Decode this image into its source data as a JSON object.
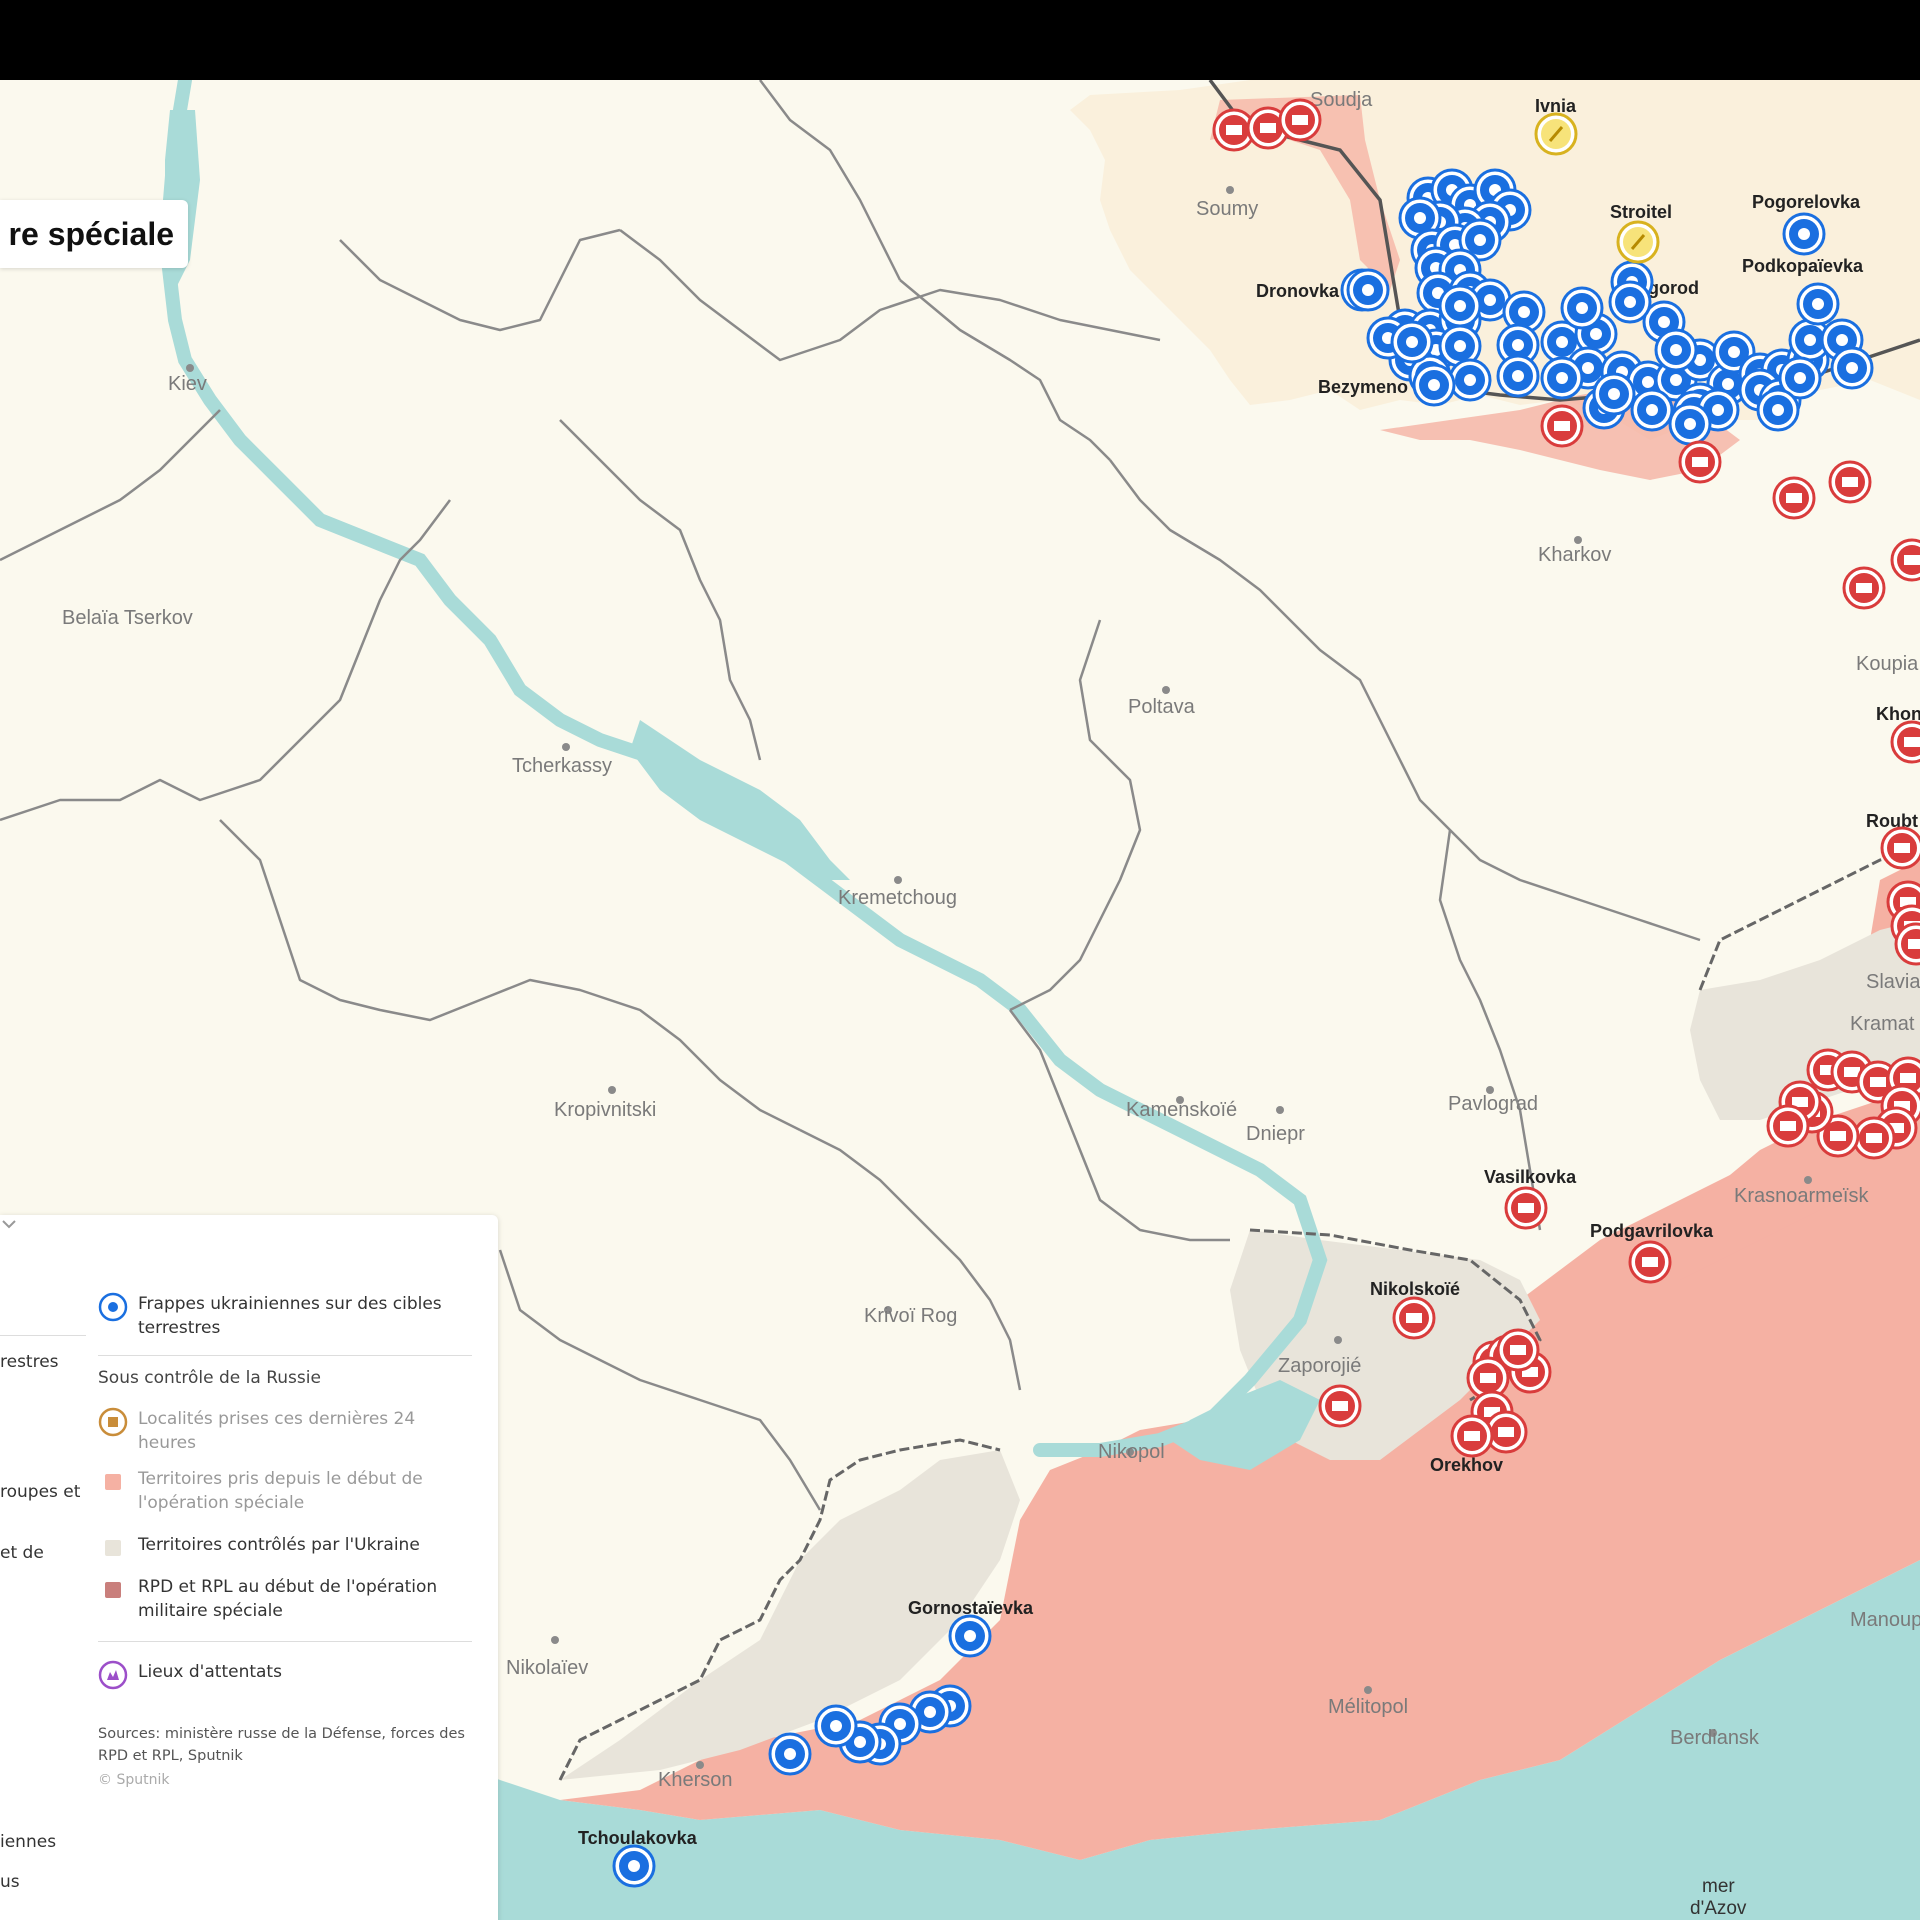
{
  "title": "re spéciale",
  "colors": {
    "land": "#fbf9ee",
    "russia_land": "#faf2de",
    "water": "#a9dbd8",
    "taken_since_start": "#f5b1a3",
    "ukraine_controlled": "#e8e4da",
    "rpd_rpl_start": "#c97f7c",
    "ukrainian_strike": "#1a6fe0",
    "taken_24h": "#c98d3a",
    "attack_site": "#9c4fc9",
    "border": "#6e6e6e"
  },
  "cities": [
    {
      "name": "Kiev"
    },
    {
      "name": "Belaïa Tserkov"
    },
    {
      "name": "Tcherkassy"
    },
    {
      "name": "Poltava"
    },
    {
      "name": "Kharkov"
    },
    {
      "name": "Soumy"
    },
    {
      "name": "Kremetchoug"
    },
    {
      "name": "Kropivnitski"
    },
    {
      "name": "Kamenskoïé"
    },
    {
      "name": "Dniepr"
    },
    {
      "name": "Pavlograd"
    },
    {
      "name": "Krivoï Rog"
    },
    {
      "name": "Zaporojié"
    },
    {
      "name": "Nikopol"
    },
    {
      "name": "Nikolaïev"
    },
    {
      "name": "Kherson"
    },
    {
      "name": "Mélitopol"
    },
    {
      "name": "Berdiansk"
    },
    {
      "name": "Krasnoarmeïsk"
    },
    {
      "name": "Slavia"
    },
    {
      "name": "Kramat"
    },
    {
      "name": "Koupia"
    },
    {
      "name": "Manoup"
    }
  ],
  "towns": [
    {
      "name": "Soudja"
    },
    {
      "name": "Ivnia"
    },
    {
      "name": "Stroitel"
    },
    {
      "name": "Pogorelovka"
    },
    {
      "name": "Podkopaïevka"
    },
    {
      "name": "Belgorod"
    },
    {
      "name": "Dronovka"
    },
    {
      "name": "Bezymeno"
    },
    {
      "name": "Khon"
    },
    {
      "name": "Roubt"
    },
    {
      "name": "Vasilkovka"
    },
    {
      "name": "Podgavrilovka"
    },
    {
      "name": "Nikolskoïé"
    },
    {
      "name": "Orekhov"
    },
    {
      "name": "Gornostaïevka"
    },
    {
      "name": "Tchoulakovka"
    }
  ],
  "sea": {
    "line1": "mer",
    "line2": "d'Azov"
  },
  "legend": {
    "left_fragments": [
      "restres",
      "roupes et",
      "et de",
      "iennes",
      "us"
    ],
    "strikes": "Frappes ukrainiennes sur des cibles terrestres",
    "section": "Sous contrôle de la Russie",
    "taken_24h": "Localités prises ces dernières 24 heures",
    "taken_since_start": "Territoires pris depuis le début de l'opération spéciale",
    "ukraine_controlled": "Territoires contrôlés par l'Ukraine",
    "rpd_rpl": "RPD et RPL au début de l'opération militaire spéciale",
    "attacks": "Lieux d'attentats",
    "sources": "Sources: ministère russe de la Défense, forces des RPD et RPL, Sputnik",
    "copyright": "© Sputnik"
  }
}
